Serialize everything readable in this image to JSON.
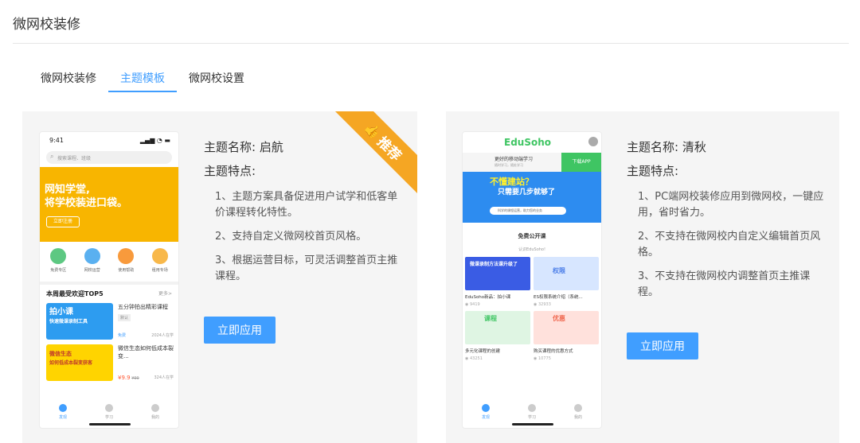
{
  "page": {
    "title": "微网校装修"
  },
  "tabs": [
    {
      "label": "微网校装修",
      "active": false
    },
    {
      "label": "主题模板",
      "active": true
    },
    {
      "label": "微网校设置",
      "active": false
    }
  ],
  "colors": {
    "accent": "#409eff",
    "ribbon": "#f5a623",
    "brand_green": "#3fc563"
  },
  "themes": [
    {
      "name_line": "主题名称: 启航",
      "features_title": "主题特点:",
      "features": [
        "1、主题方案具备促进用户试学和低客单价课程转化特性。",
        "2、支持自定义微网校首页风格。",
        "3、根据运营目标，可灵活调整首页主推课程。"
      ],
      "apply_label": "立即应用",
      "ribbon_label": "推荐",
      "ribbon_icon": "thumbs-up-icon",
      "preview": {
        "time": "9:41",
        "signal": "▂▄▆ ◔ ▬",
        "search_placeholder": "搜索课程、班级",
        "banner_title_1": "网知学堂,",
        "banner_title_2": "将学校装进口袋。",
        "banner_button": "立即注册",
        "icons": [
          "免费专区",
          "网校运营",
          "使用帮助",
          "租用专场"
        ],
        "section_title": "本周最受欢迎TOP5",
        "section_more": "更多>",
        "courses": [
          {
            "thumb_text_1": "拍小课",
            "thumb_text_2": "快速微课录制工具",
            "title": "五分钟拍出精彩课程",
            "tag": "默认",
            "price": "免费",
            "students": "2024人在学"
          },
          {
            "thumb_text_1": "微信生态",
            "thumb_text_2": "如何低成本裂变获客",
            "title": "微信生态如何低成本裂变...",
            "tag": "",
            "price": "¥9.9",
            "old_price": "¥99",
            "students": "324人在学"
          }
        ],
        "tabbar": [
          "发现",
          "学习",
          "我的"
        ]
      }
    },
    {
      "name_line": "主题名称: 清秋",
      "features_title": "主题特点:",
      "features": [
        "1、PC端网校装修应用到微网校，一键应用，省时省力。",
        "2、不支持在微网校内自定义编辑首页风格。",
        "3、不支持在微网校内调整首页主推课程。"
      ],
      "apply_label": "立即应用",
      "preview": {
        "logo": "EduSoho",
        "bar_title": "更好的移动端学习",
        "bar_sub": "随时学习，随处学习",
        "download": "下载APP",
        "banner_1": "不懂建站？",
        "banner_2": "只需要几步就够了",
        "banner_bar": "科学的课程运营，助力您的业务",
        "free_title": "免费公开课",
        "free_sub": "认识EduSoho!",
        "courses": [
          {
            "img_text": "微课录制方法课升级了",
            "caption": "EduSoho新品：拍小课",
            "views": "9419",
            "color": "#3a5ce4"
          },
          {
            "img_text": "权限",
            "caption": "ES权限系统介绍（系统...",
            "views": "32933",
            "color": "#d7e6ff"
          },
          {
            "img_text": "课程",
            "caption": "多元化课程的创建",
            "views": "43251",
            "color": "#dff5e3"
          },
          {
            "img_text": "优惠",
            "caption": "购买课程的优惠方式",
            "views": "10775",
            "color": "#ffe1dc"
          }
        ],
        "tabbar": [
          "发现",
          "学习",
          "我的"
        ]
      }
    }
  ]
}
